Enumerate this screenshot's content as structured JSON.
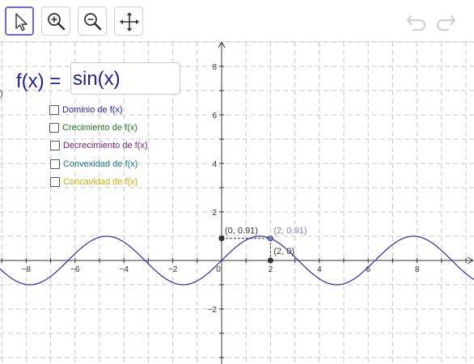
{
  "toolbar": {
    "tools": [
      {
        "name": "move-tool",
        "icon": "arrow-pointer-icon",
        "active": true
      },
      {
        "name": "zoom-in-tool",
        "icon": "zoom-in-icon",
        "active": false
      },
      {
        "name": "zoom-out-tool",
        "icon": "zoom-out-icon",
        "active": false
      },
      {
        "name": "move-view-tool",
        "icon": "move-arrows-icon",
        "active": false
      }
    ],
    "undo_icon": "undo-icon",
    "redo_icon": "redo-icon"
  },
  "formula": {
    "lhs": "f(x) =",
    "value": "sin(x)"
  },
  "paren_stub": ")",
  "checkboxes": [
    {
      "label": "Dominio de f(x)",
      "color": "#1f1fc9",
      "checked": false
    },
    {
      "label": "Crecimiento de f(x)",
      "color": "#1a7a1a",
      "checked": false
    },
    {
      "label": "Decrecimiento de f(x)",
      "color": "#7a1a7a",
      "checked": false
    },
    {
      "label": "Convexidad de f(x)",
      "color": "#1a7a7a",
      "checked": false
    },
    {
      "label": "Concavidad de f(x)",
      "color": "#c8b400",
      "checked": false
    }
  ],
  "axes": {
    "x_ticks": [
      "−8",
      "−6",
      "−4",
      "−2",
      "0",
      "2",
      "4",
      "6",
      "8"
    ],
    "y_ticks": [
      "8",
      "6",
      "4",
      "2",
      "−2"
    ]
  },
  "points": [
    {
      "label": "(0, 0.91)",
      "x": 0,
      "y": 0.91,
      "color": "#333333"
    },
    {
      "label": "(2, 0.91)",
      "x": 2,
      "y": 0.91,
      "color": "#7a7ad6"
    },
    {
      "label": "(2, 0)",
      "x": 2,
      "y": 0,
      "color": "#333333"
    }
  ],
  "curve": {
    "function": "sin(x)",
    "color": "#2a2ab0"
  }
}
